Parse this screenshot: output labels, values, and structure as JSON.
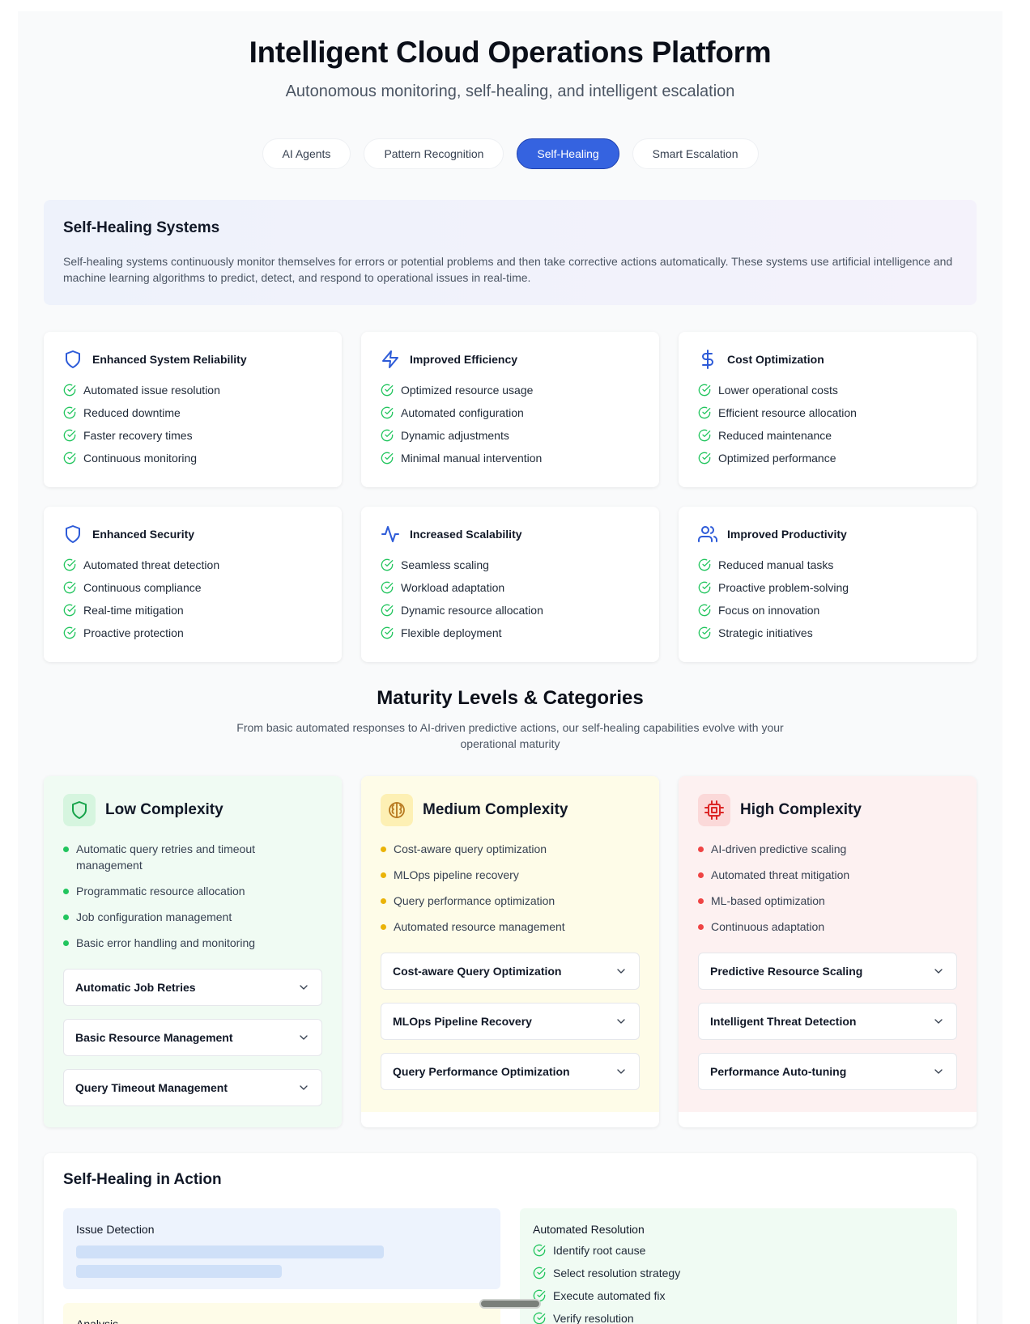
{
  "header": {
    "title": "Intelligent Cloud Operations Platform",
    "subtitle": "Autonomous monitoring, self-healing, and intelligent escalation"
  },
  "tabs": [
    {
      "label": "AI Agents",
      "active": false
    },
    {
      "label": "Pattern Recognition",
      "active": false
    },
    {
      "label": "Self-Healing",
      "active": true
    },
    {
      "label": "Smart Escalation",
      "active": false
    }
  ],
  "intro": {
    "title": "Self-Healing Systems",
    "text": "Self-healing systems continuously monitor themselves for errors or potential problems and then take corrective actions automatically. These systems use artificial intelligence and machine learning algorithms to predict, detect, and respond to operational issues in real-time."
  },
  "benefits": [
    {
      "icon": "shield-icon",
      "title": "Enhanced System Reliability",
      "items": [
        "Automated issue resolution",
        "Reduced downtime",
        "Faster recovery times",
        "Continuous monitoring"
      ]
    },
    {
      "icon": "lightning-icon",
      "title": "Improved Efficiency",
      "items": [
        "Optimized resource usage",
        "Automated configuration",
        "Dynamic adjustments",
        "Minimal manual intervention"
      ]
    },
    {
      "icon": "dollar-icon",
      "title": "Cost Optimization",
      "items": [
        "Lower operational costs",
        "Efficient resource allocation",
        "Reduced maintenance",
        "Optimized performance"
      ]
    },
    {
      "icon": "shield-icon",
      "title": "Enhanced Security",
      "items": [
        "Automated threat detection",
        "Continuous compliance",
        "Real-time mitigation",
        "Proactive protection"
      ]
    },
    {
      "icon": "activity-icon",
      "title": "Increased Scalability",
      "items": [
        "Seamless scaling",
        "Workload adaptation",
        "Dynamic resource allocation",
        "Flexible deployment"
      ]
    },
    {
      "icon": "users-icon",
      "title": "Improved Productivity",
      "items": [
        "Reduced manual tasks",
        "Proactive problem-solving",
        "Focus on innovation",
        "Strategic initiatives"
      ]
    }
  ],
  "maturity": {
    "title": "Maturity Levels & Categories",
    "subtitle": "From basic automated responses to AI-driven predictive actions, our self-healing capabilities evolve with your operational maturity",
    "levels": [
      {
        "icon": "shield-icon",
        "title": "Low Complexity",
        "items": [
          "Automatic query retries and timeout management",
          "Programmatic resource allocation",
          "Job configuration management",
          "Basic error handling and monitoring"
        ],
        "accordions": [
          "Automatic Job Retries",
          "Basic Resource Management",
          "Query Timeout Management"
        ]
      },
      {
        "icon": "brain-icon",
        "title": "Medium Complexity",
        "items": [
          "Cost-aware query optimization",
          "MLOps pipeline recovery",
          "Query performance optimization",
          "Automated resource management"
        ],
        "accordions": [
          "Cost-aware Query Optimization",
          "MLOps Pipeline Recovery",
          "Query Performance Optimization"
        ]
      },
      {
        "icon": "cpu-icon",
        "title": "High Complexity",
        "items": [
          "AI-driven predictive scaling",
          "Automated threat mitigation",
          "ML-based optimization",
          "Continuous adaptation"
        ],
        "accordions": [
          "Predictive Resource Scaling",
          "Intelligent Threat Detection",
          "Performance Auto-tuning"
        ]
      }
    ]
  },
  "action": {
    "title": "Self-Healing in Action",
    "detection_title": "Issue Detection",
    "analysis_title": "Analysis",
    "resolution_title": "Automated Resolution",
    "resolution_steps": [
      "Identify root cause",
      "Select resolution strategy",
      "Execute automated fix",
      "Verify resolution"
    ]
  },
  "colors": {
    "accent": "#3563e0",
    "icon_blue": "#2d5bd8",
    "check_green": "#22c55e",
    "low_bg": "#f0fbf3",
    "medium_bg": "#fefce8",
    "high_bg": "#fdf1f1"
  }
}
